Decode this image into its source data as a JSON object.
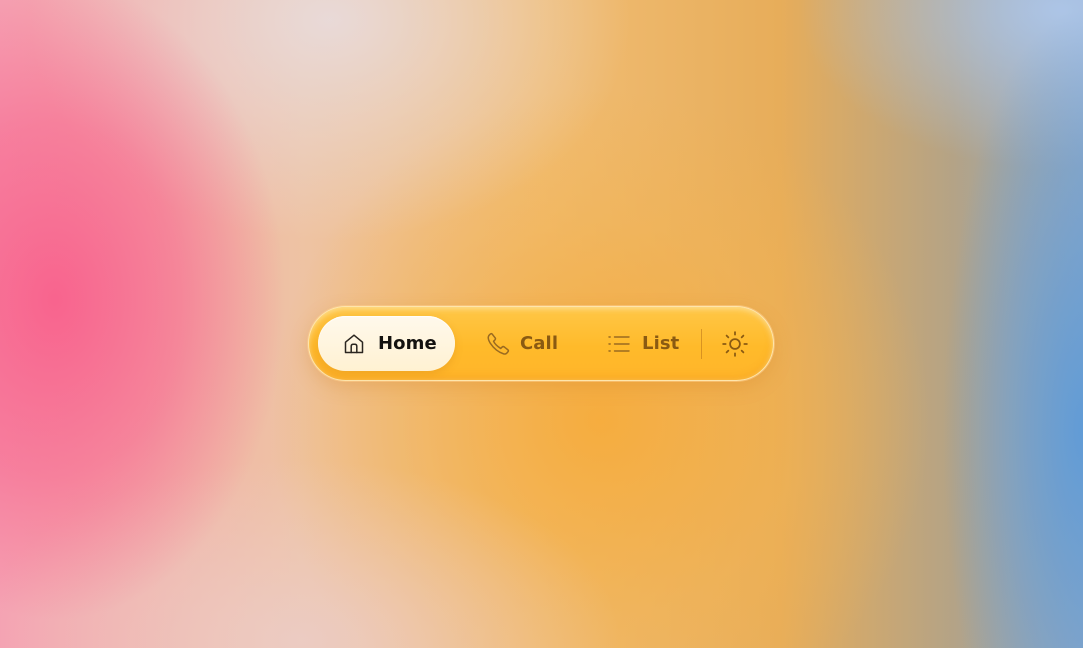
{
  "nav": {
    "items": [
      {
        "label": "Home",
        "icon": "home-icon",
        "active": true
      },
      {
        "label": "Call",
        "icon": "phone-icon",
        "active": false
      },
      {
        "label": "List",
        "icon": "list-icon",
        "active": false
      }
    ],
    "theme_toggle_icon": "sun-icon"
  },
  "colors": {
    "dock_background": "#ffba2a",
    "active_pill": "#fff6e4",
    "active_text": "#141210",
    "muted_text": "#8a5a12",
    "background_pink": "#f8608c",
    "background_blue": "#5f9bd7"
  }
}
